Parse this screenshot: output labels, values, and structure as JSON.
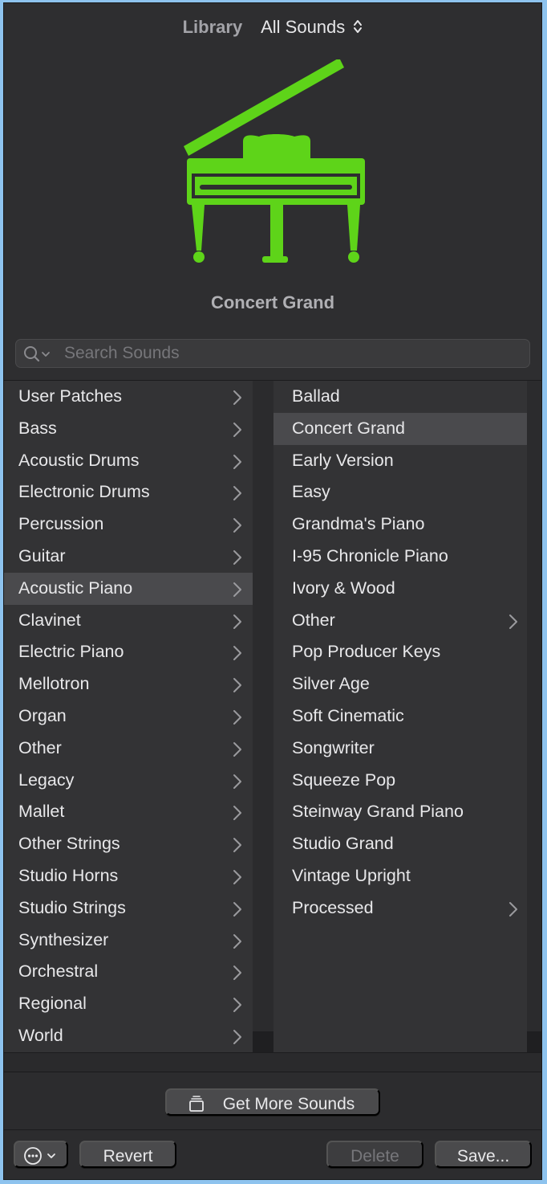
{
  "header": {
    "library_label": "Library",
    "library_value": "All Sounds",
    "patch_name": "Concert Grand",
    "instrument_icon": "grand-piano-icon",
    "accent_color": "#5ed419"
  },
  "search": {
    "placeholder": "Search Sounds",
    "value": ""
  },
  "categories": [
    {
      "label": "User Patches"
    },
    {
      "label": "Bass"
    },
    {
      "label": "Acoustic Drums"
    },
    {
      "label": "Electronic Drums"
    },
    {
      "label": "Percussion"
    },
    {
      "label": "Guitar"
    },
    {
      "label": "Acoustic Piano",
      "selected": true
    },
    {
      "label": "Clavinet"
    },
    {
      "label": "Electric Piano"
    },
    {
      "label": "Mellotron"
    },
    {
      "label": "Organ"
    },
    {
      "label": "Other"
    },
    {
      "label": "Legacy"
    },
    {
      "label": "Mallet"
    },
    {
      "label": "Other Strings"
    },
    {
      "label": "Studio Horns"
    },
    {
      "label": "Studio Strings"
    },
    {
      "label": "Synthesizer"
    },
    {
      "label": "Orchestral"
    },
    {
      "label": "Regional"
    },
    {
      "label": "World"
    }
  ],
  "patches": [
    {
      "label": "Ballad"
    },
    {
      "label": "Concert Grand",
      "selected": true
    },
    {
      "label": "Early Version"
    },
    {
      "label": "Easy"
    },
    {
      "label": "Grandma's Piano"
    },
    {
      "label": "I-95 Chronicle Piano"
    },
    {
      "label": "Ivory & Wood"
    },
    {
      "label": "Other",
      "folder": true
    },
    {
      "label": "Pop Producer Keys"
    },
    {
      "label": "Silver Age"
    },
    {
      "label": "Soft Cinematic"
    },
    {
      "label": "Songwriter"
    },
    {
      "label": "Squeeze Pop"
    },
    {
      "label": "Steinway Grand Piano"
    },
    {
      "label": "Studio Grand"
    },
    {
      "label": "Vintage Upright"
    },
    {
      "label": "Processed",
      "folder": true
    }
  ],
  "footer": {
    "get_more_label": "Get More Sounds",
    "revert_label": "Revert",
    "delete_label": "Delete",
    "save_label": "Save..."
  }
}
